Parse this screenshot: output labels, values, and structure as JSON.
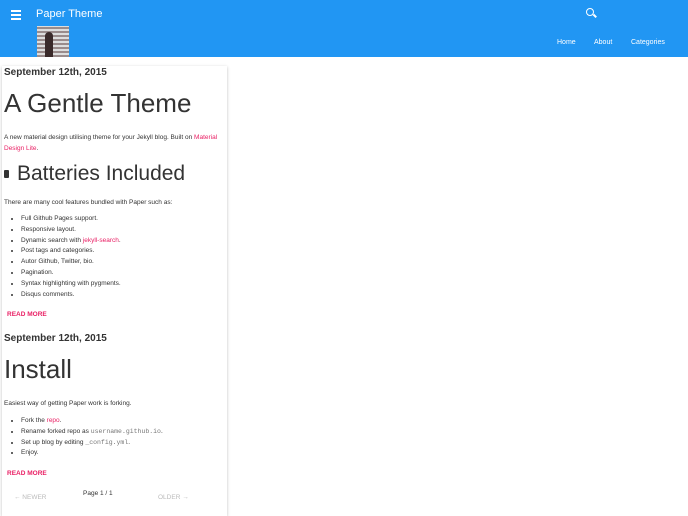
{
  "header": {
    "title": "Paper Theme",
    "nav": [
      "Home",
      "About",
      "Categories"
    ]
  },
  "posts": [
    {
      "date": "September 12th, 2015",
      "title": "A Gentle Theme",
      "intro": "A new material design utilising theme for your Jekyll blog. Built on ",
      "intro_link": "Material Design Lite",
      "subtitle": "Batteries Included",
      "text": "There are many cool features bundled with Paper such as:",
      "items": [
        "Full Github Pages support.",
        "Responsive layout.",
        "Dynamic search with ",
        "Post tags and categories.",
        "Autor Github, Twitter, bio.",
        "Pagination.",
        "Syntax highlighting with pygments.",
        "Disqus comments."
      ],
      "item_link": "jekyll-search",
      "read_more": "READ MORE"
    },
    {
      "date": "September 12th, 2015",
      "title": "Install",
      "text": "Easiest way of getting Paper work is forking.",
      "items": [
        "Fork the ",
        "Rename forked repo as ",
        "Set up blog by editing ",
        "Enjoy."
      ],
      "link": "repo",
      "code1": "username.github.io",
      "code2": "_config.yml",
      "read_more": "READ MORE"
    }
  ],
  "pagination": {
    "newer": "← NEWER",
    "page": "Page 1 / 1",
    "older": "OLDER →"
  }
}
